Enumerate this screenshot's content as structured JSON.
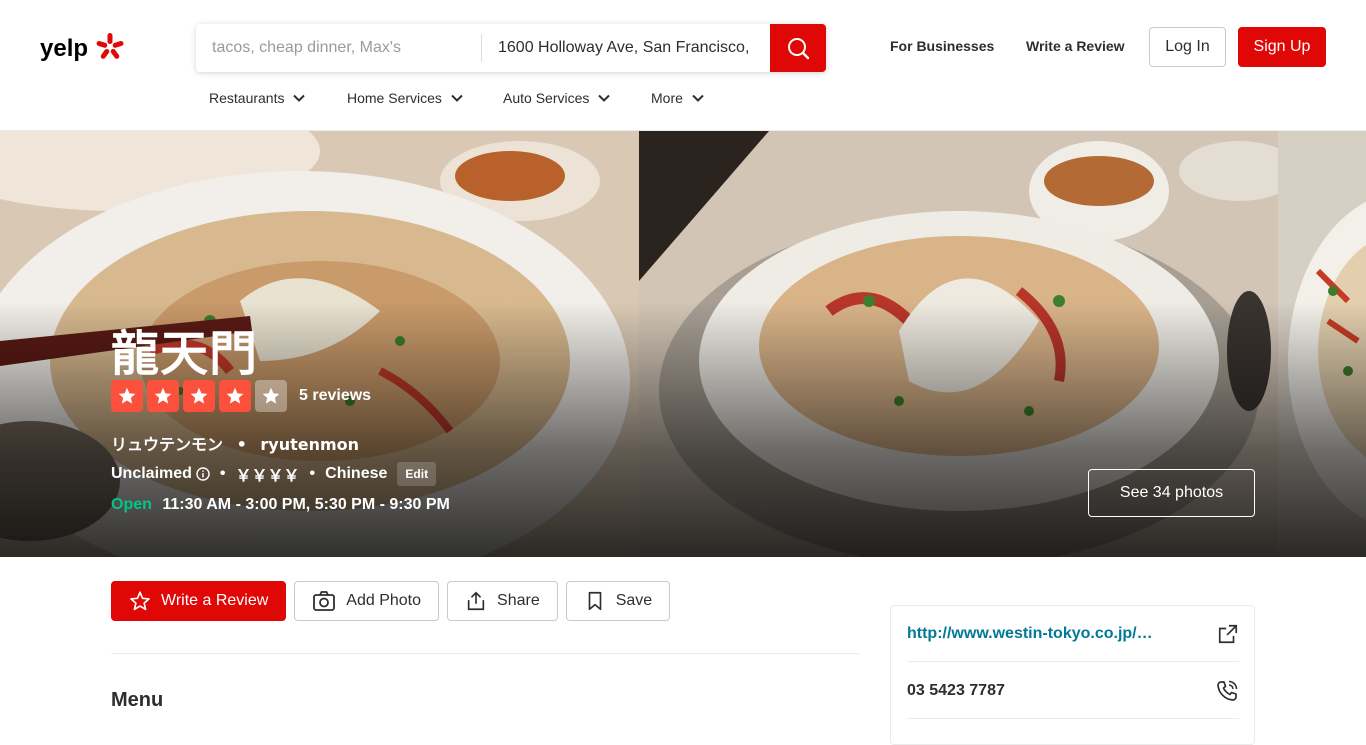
{
  "header": {
    "logo_text": "yelp",
    "search_find_placeholder": "tacos, cheap dinner, Max's",
    "search_near_value": "1600 Holloway Ave, San Francisco,",
    "for_businesses": "For Businesses",
    "write_review": "Write a Review",
    "login": "Log In",
    "signup": "Sign Up",
    "categories": [
      "Restaurants",
      "Home Services",
      "Auto Services",
      "More"
    ]
  },
  "business": {
    "name": "龍天門",
    "rating": 4,
    "rating_max": 5,
    "reviews": "5 reviews",
    "alt_name_ja": "リュウテンモン",
    "alt_name_romaji": "ryutenmon",
    "claim_status": "Unclaimed",
    "price": "￥￥￥￥",
    "category": "Chinese",
    "edit": "Edit",
    "open_status": "Open",
    "hours": "11:30 AM - 3:00 PM, 5:30 PM - 9:30 PM",
    "see_photos": "See 34 photos"
  },
  "actions": {
    "write_review": "Write a Review",
    "add_photo": "Add Photo",
    "share": "Share",
    "save": "Save"
  },
  "main": {
    "menu_title": "Menu"
  },
  "sidebar": {
    "website": "http://www.westin-tokyo.co.jp/…",
    "phone": "03 5423 7787"
  },
  "colors": {
    "brand_red": "#e00707",
    "star_red": "#fb503b",
    "open_green": "#04c585",
    "link_teal": "#027a97"
  }
}
